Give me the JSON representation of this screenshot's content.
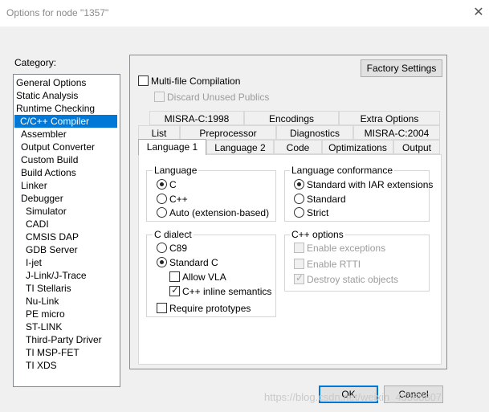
{
  "window": {
    "title": "Options for node \"1357\""
  },
  "category": {
    "label": "Category:",
    "items": [
      {
        "label": "General Options"
      },
      {
        "label": "Static Analysis"
      },
      {
        "label": "Runtime Checking"
      },
      {
        "label": "C/C++ Compiler"
      },
      {
        "label": "Assembler"
      },
      {
        "label": "Output Converter"
      },
      {
        "label": "Custom Build"
      },
      {
        "label": "Build Actions"
      },
      {
        "label": "Linker"
      },
      {
        "label": "Debugger"
      },
      {
        "label": "Simulator"
      },
      {
        "label": "CADI"
      },
      {
        "label": "CMSIS DAP"
      },
      {
        "label": "GDB Server"
      },
      {
        "label": "I-jet"
      },
      {
        "label": "J-Link/J-Trace"
      },
      {
        "label": "TI Stellaris"
      },
      {
        "label": "Nu-Link"
      },
      {
        "label": "PE micro"
      },
      {
        "label": "ST-LINK"
      },
      {
        "label": "Third-Party Driver"
      },
      {
        "label": "TI MSP-FET"
      },
      {
        "label": "TI XDS"
      }
    ]
  },
  "factory_settings": "Factory Settings",
  "multifile": {
    "label": "Multi-file Compilation",
    "checked": false
  },
  "discard_unused": {
    "label": "Discard Unused Publics",
    "checked": false
  },
  "tabs": {
    "row1": [
      "MISRA-C:1998",
      "Encodings",
      "Extra Options"
    ],
    "row2": [
      "List",
      "Preprocessor",
      "Diagnostics",
      "MISRA-C:2004"
    ],
    "row3": [
      "Language 1",
      "Language 2",
      "Code",
      "Optimizations",
      "Output"
    ]
  },
  "language": {
    "title": "Language",
    "options": [
      "C",
      "C++",
      "Auto (extension-based)"
    ],
    "selected": "C"
  },
  "conformance": {
    "title": "Language conformance",
    "options": [
      "Standard with IAR extensions",
      "Standard",
      "Strict"
    ],
    "selected": "Standard with IAR extensions"
  },
  "c_dialect": {
    "title": "C dialect",
    "options": [
      "C89",
      "Standard C"
    ],
    "selected": "Standard C",
    "allow_vla": "Allow VLA",
    "inline_semantics": "C++ inline semantics",
    "require_prototypes": "Require prototypes"
  },
  "cpp_options": {
    "title": "C++ options",
    "enable_exceptions": "Enable exceptions",
    "enable_rtti": "Enable RTTI",
    "destroy_static": "Destroy static objects"
  },
  "buttons": {
    "ok": "OK",
    "cancel": "Cancel"
  },
  "watermark": "https://blog.csdn.net/weixin_43368807"
}
